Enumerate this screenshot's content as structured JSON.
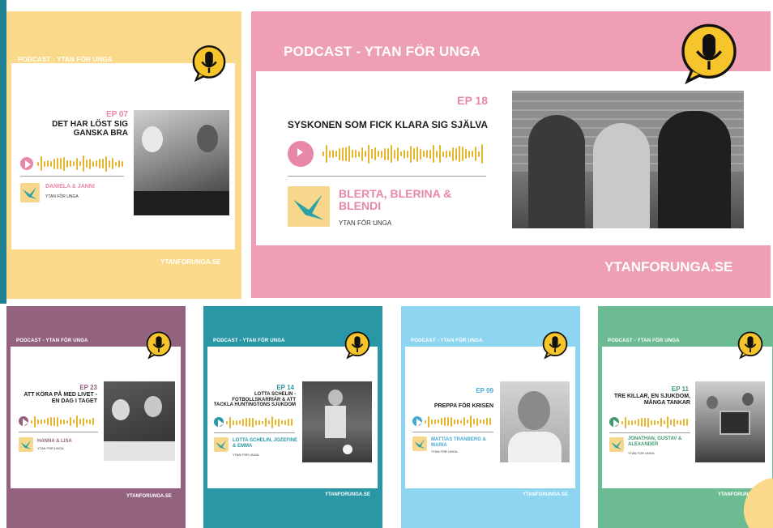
{
  "brand": {
    "header": "PODCAST - YTAN FÖR UNGA",
    "footer_upper": "YTANFORUNGA.SE",
    "footer_lower": "ytanforunga.se",
    "org": "YTAN FÖR UNGA"
  },
  "colors": {
    "yellow": "#fbd98a",
    "pink": "#ee9fb3",
    "purple": "#93627f",
    "teal": "#2a97a6",
    "blue": "#8ed5f1",
    "green": "#6dbb92"
  },
  "episodes": [
    {
      "ep": "EP 07",
      "title": "DET HAR LÖST SIG GANSKA BRA",
      "guests": "DANIELA & JANNI"
    },
    {
      "ep": "EP 18",
      "title": "SYSKONEN SOM FICK KLARA SIG SJÄLVA",
      "guests": "BLERTA, BLERINA & BLENDI"
    },
    {
      "ep": "EP 23",
      "title": "ATT KÖRA PÅ MED LIVET - EN DAG I TAGET",
      "guests": "HANNA & LISA"
    },
    {
      "ep": "EP 14",
      "title": "LOTTA SCHELIN - FOTBOLLSKARRIÄR & ATT TACKLA HUNTINGTONS SJUKDOM",
      "guests": "LOTTA SCHELIN, JOZEFINE & EMMA"
    },
    {
      "ep": "EP 09",
      "title": "PREPPA FÖR KRISEN",
      "guests": "MATTIAS TRANBERG & MARIA"
    },
    {
      "ep": "EP 11",
      "title": "TRE KILLAR, EN SJUKDOM, MÅNGA TANKAR",
      "guests": "JONATHAN, GUSTAV & ALEXANDER"
    }
  ],
  "icons": {
    "mic": "microphone-icon",
    "play": "play-icon",
    "bird": "bird-logo-icon"
  }
}
